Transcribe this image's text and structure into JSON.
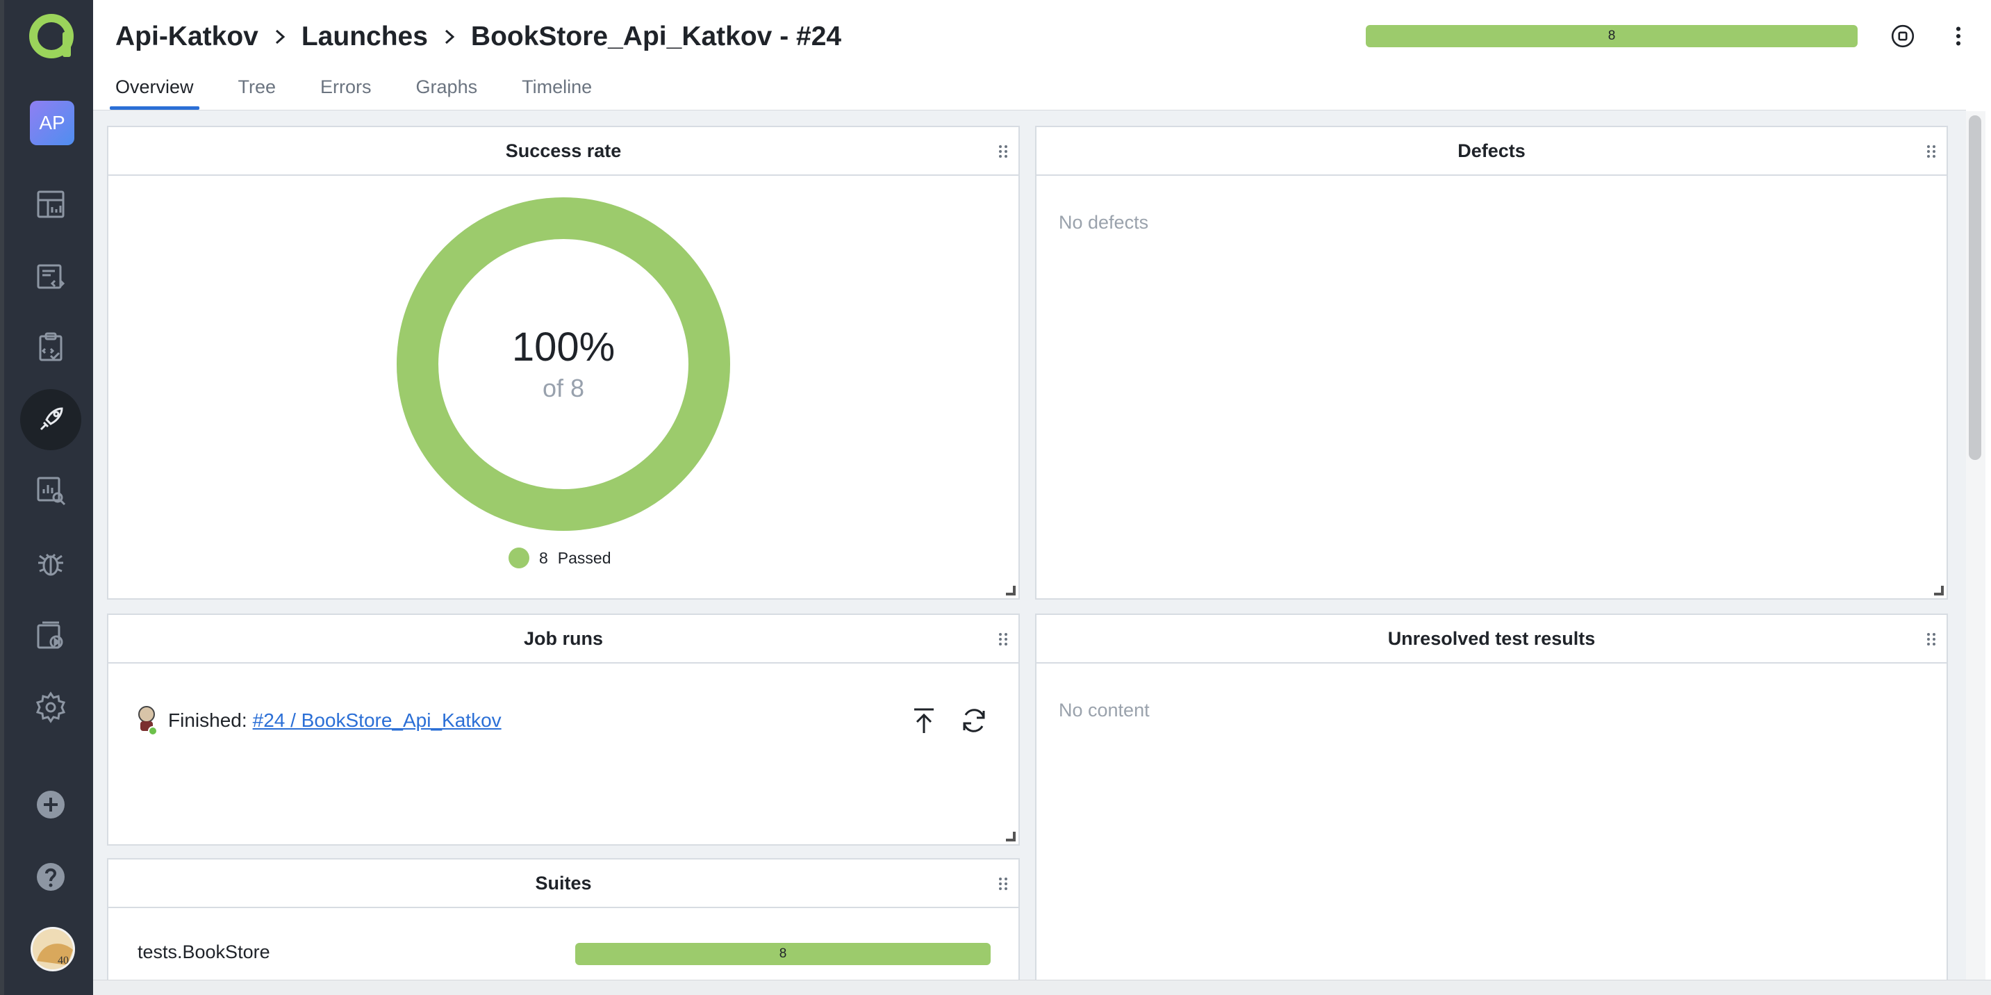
{
  "header": {
    "breadcrumb": [
      "Api-Katkov",
      "Launches",
      "BookStore_Api_Katkov - #24"
    ],
    "progress_label": "8",
    "colors": {
      "passed": "#9ccb6c",
      "accent": "#2b6fd6"
    }
  },
  "sidebar": {
    "project_badge": "AP",
    "items": [
      {
        "icon": "dashboards-icon"
      },
      {
        "icon": "test-cases-icon"
      },
      {
        "icon": "test-plans-icon"
      },
      {
        "icon": "launches-icon",
        "active": true
      },
      {
        "icon": "analytics-icon"
      },
      {
        "icon": "defects-icon"
      },
      {
        "icon": "jobs-icon"
      },
      {
        "icon": "settings-icon"
      },
      {
        "icon": "add-icon"
      },
      {
        "icon": "help-icon"
      }
    ],
    "avatar_text": "40"
  },
  "tabs": [
    "Overview",
    "Tree",
    "Errors",
    "Graphs",
    "Timeline"
  ],
  "widgets": {
    "success_rate": {
      "title": "Success rate",
      "percent_label": "100%",
      "of_label": "of 8",
      "passed_fraction": 1.0,
      "legend_count": "8",
      "legend_label": "Passed"
    },
    "defects": {
      "title": "Defects",
      "empty_text": "No defects"
    },
    "job_runs": {
      "title": "Job runs",
      "status_label": "Finished:",
      "link_text": "#24 / BookStore_Api_Katkov"
    },
    "unresolved": {
      "title": "Unresolved test results",
      "empty_text": "No content"
    },
    "suites": {
      "title": "Suites",
      "rows": [
        {
          "name": "tests.BookStore",
          "count": "8",
          "passed_fraction": 1.0
        }
      ]
    }
  }
}
